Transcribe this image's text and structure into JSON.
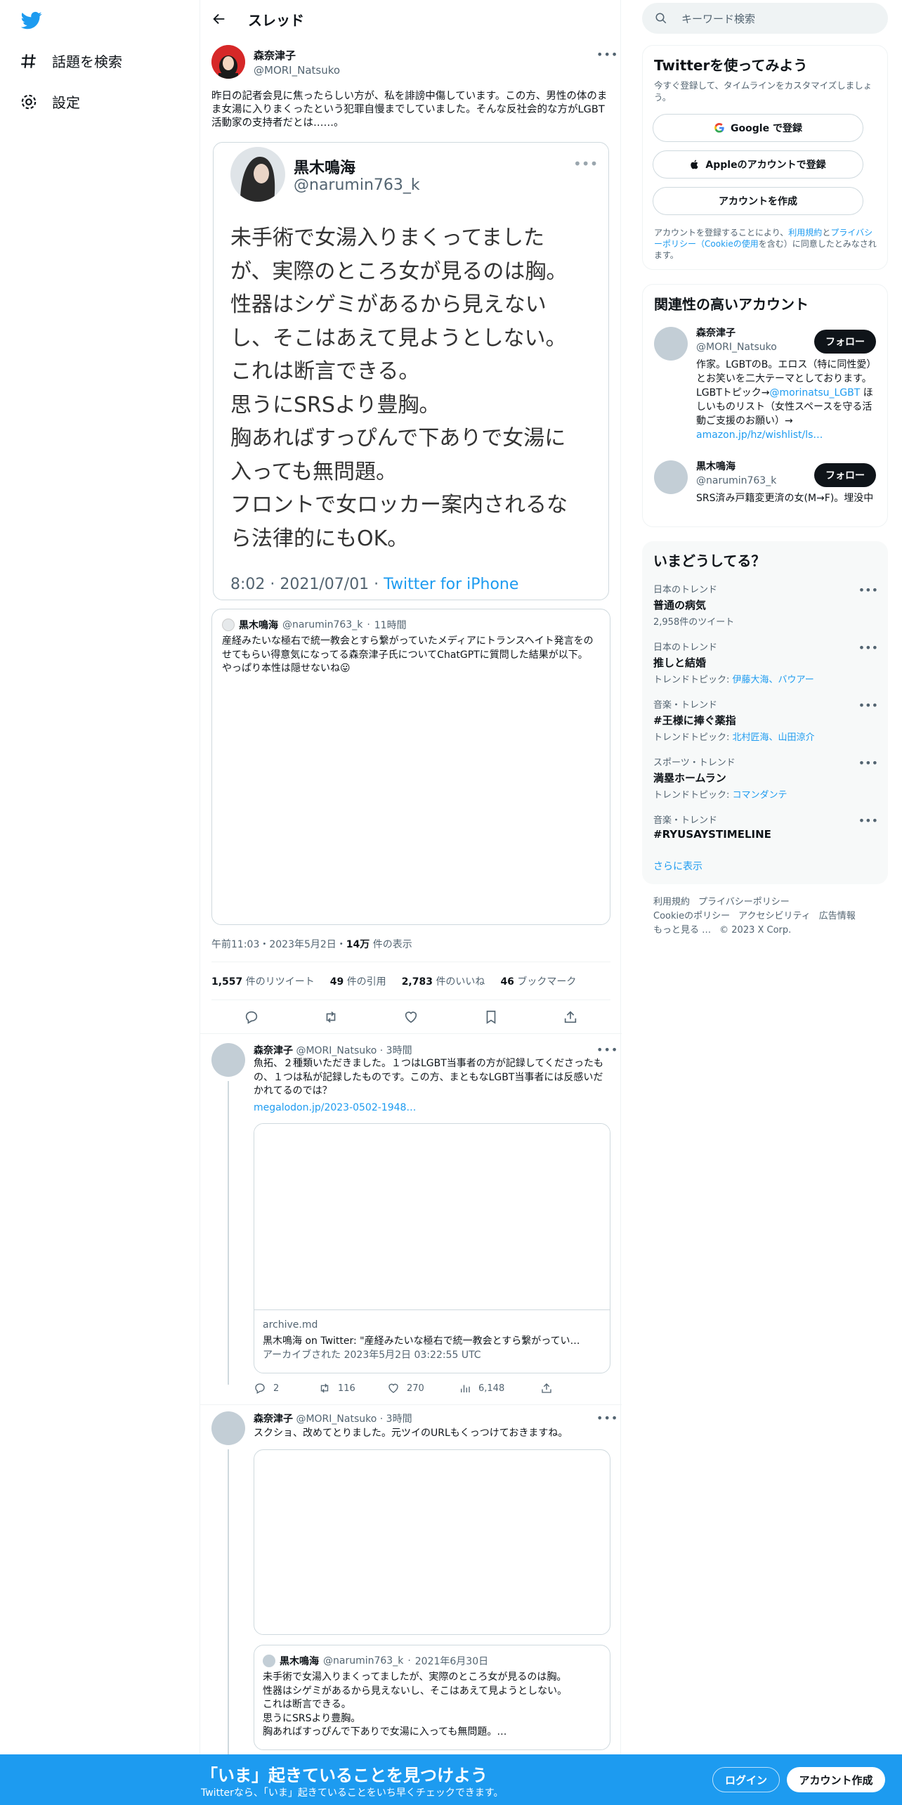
{
  "nav": {
    "explore_label": "話題を検索",
    "settings_label": "設定"
  },
  "header": {
    "title": "スレッド"
  },
  "main_tweet": {
    "name": "森奈津子",
    "handle": "@MORI_Natsuko",
    "text": "昨日の記者会見に焦ったらしい方が、私を誹謗中傷しています。この方、男性の体のまま女湯に入りまくったという犯罪自慢までしていました。そんな反社会的な方がLGBT活動家の支持者だとは……。",
    "embed": {
      "name": "黒木鳴海",
      "handle": "@narumin763_k",
      "lines": [
        "未手術で女湯入りまくってました",
        "が、実際のところ女が見るのは胸。",
        "性器はシゲミがあるから見えない",
        "し、そこはあえて見ようとしない。",
        "これは断言できる。",
        "思うにSRSより豊胸。",
        "胸あればすっぴんで下ありで女湯に",
        "入っても無問題。",
        "フロントで女ロッカー案内されるな",
        "ら法律的にもOK。"
      ],
      "time": "8:02 · 2021/07/01 · ",
      "client": "Twitter for iPhone"
    },
    "quote": {
      "name": "黒木鳴海",
      "handle": "@narumin763_k",
      "time": "11時間",
      "text": "産経みたいな極右で統一教会とすら繋がっていたメディアにトランスヘイト発言をのせてもらい得意気になってる森奈津子氏についてChatGPTに質問した結果が以下。\nやっぱり本性は隠せないね😛"
    },
    "timestamp": "午前11:03・2023年5月2日・",
    "views_num": "14万",
    "views_label": "件の表示",
    "stats": {
      "retweets": "1,557",
      "retweets_label": "件のリツイート",
      "quotes": "49",
      "quotes_label": "件の引用",
      "likes": "2,783",
      "likes_label": "件のいいね",
      "bookmarks": "46",
      "bookmarks_label": "ブックマーク"
    }
  },
  "reply1": {
    "name": "森奈津子",
    "handle": "@MORI_Natsuko",
    "time": "3時間",
    "text": "魚拓、２種類いただきました。１つはLGBT当事者の方が記録してくださったもの、１つは私が記録したものです。この方、まともなLGBT当事者には反感いだかれてるのでは？",
    "link": "megalodon.jp/2023-0502-1948…",
    "card": {
      "domain": "archive.md",
      "title": "黒木鳴海 on Twitter: \"産経みたいな極右で統一教会とすら繋がってい…",
      "desc": "アーカイブされた 2023年5月2日 03:22:55 UTC"
    },
    "replies": "2",
    "retweets": "116",
    "likes": "270",
    "views": "6,148"
  },
  "reply2": {
    "name": "森奈津子",
    "handle": "@MORI_Natsuko",
    "time": "3時間",
    "text": "スクショ、改めてとりました。元ツイのURLもくっつけておきますね。",
    "quote": {
      "name": "黒木鳴海",
      "handle": "@narumin763_k",
      "time": "2021年6月30日",
      "text": "未手術で女湯入りまくってましたが、実際のところ女が見るのは胸。\n性器はシゲミがあるから見えないし、そこはあえて見ようとしない。\nこれは断言できる。\n思うにSRSより豊胸。\n胸あればすっぴんで下ありで女湯に入っても無問題。…"
    }
  },
  "sidebar": {
    "search_placeholder": "キーワード検索",
    "signup": {
      "title": "Twitterを使ってみよう",
      "desc": "今すぐ登録して、タイムラインをカスタマイズしましょう。",
      "google": "Google で登録",
      "apple": "Appleのアカウントで登録",
      "create": "アカウントを作成",
      "terms_1": "アカウントを登録することにより、",
      "terms_link1": "利用規約",
      "terms_2": "と",
      "terms_link2": "プライバシーポリシー（Cookieの使用",
      "terms_3": "を含む）に同意したとみなされます。"
    },
    "related": {
      "title": "関連性の高いアカウント",
      "follow": "フォロー",
      "accounts": [
        {
          "name": "森奈津子",
          "handle": "@MORI_Natsuko",
          "bio": "作家。LGBTのB。エロス（特に同性愛）とお笑いを二大テーマとしております。LGBTトピック→",
          "bio_link": "@morinatsu_LGBT",
          "bio2": " ほしいものリスト（女性スペースを守る活動ご支援のお願い）→ ",
          "bio_link2": "amazon.jp/hz/wishlist/ls…"
        },
        {
          "name": "黒木鳴海",
          "handle": "@narumin763_k",
          "bio": "SRS済み戸籍変更済の女(M→F)。埋没中"
        }
      ]
    },
    "trends": {
      "title": "いまどうしてる？",
      "items": [
        {
          "cat": "日本のトレンド",
          "title": "普通の病気",
          "sub": "2,958件のツイート"
        },
        {
          "cat": "日本のトレンド",
          "title": "推しと結婚",
          "sub_label": "トレンドトピック: ",
          "sub_link": "伊藤大海、バウアー"
        },
        {
          "cat": "音楽・トレンド",
          "title": "#王様に捧ぐ薬指",
          "sub_label": "トレンドトピック: ",
          "sub_link": "北村匠海、山田涼介"
        },
        {
          "cat": "スポーツ・トレンド",
          "title": "満塁ホームラン",
          "sub_label": "トレンドトピック: ",
          "sub_link": "コマンダンテ"
        },
        {
          "cat": "音楽・トレンド",
          "title": "#RYUSAYSTIMELINE"
        }
      ],
      "more": "さらに表示"
    },
    "footer": {
      "line1": [
        "利用規約",
        "プライバシーポリシー"
      ],
      "line2": [
        "Cookieのポリシー",
        "アクセシビリティ",
        "広告情報"
      ],
      "line3": [
        "もっと見る …",
        "© 2023 X Corp."
      ]
    }
  },
  "banner": {
    "title": "「いま」起きていることを見つけよう",
    "subtitle": "Twitterなら、「いま」起きていることをいち早くチェックできます。",
    "login": "ログイン",
    "signup": "アカウント作成"
  },
  "colors": {
    "accent": "#1d9bf0",
    "text": "#0f1419",
    "muted": "#536471"
  }
}
